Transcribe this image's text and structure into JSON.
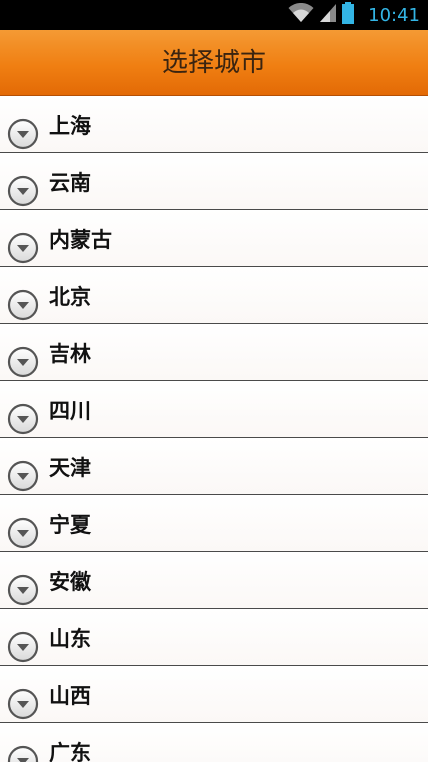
{
  "status_bar": {
    "time": "10:41",
    "icons": [
      "wifi-icon",
      "signal-icon",
      "battery-icon"
    ],
    "time_color": "#33b5e5"
  },
  "header": {
    "title": "选择城市",
    "background_color": "#f07f12"
  },
  "list": {
    "item_icon": "chevron-down-circle-icon",
    "items": [
      {
        "label": "上海"
      },
      {
        "label": "云南"
      },
      {
        "label": "内蒙古"
      },
      {
        "label": "北京"
      },
      {
        "label": "吉林"
      },
      {
        "label": "四川"
      },
      {
        "label": "天津"
      },
      {
        "label": "宁夏"
      },
      {
        "label": "安徽"
      },
      {
        "label": "山东"
      },
      {
        "label": "山西"
      },
      {
        "label": "广东"
      }
    ]
  }
}
